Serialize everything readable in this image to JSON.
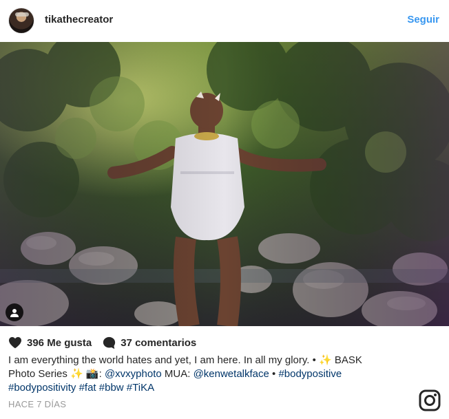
{
  "post": {
    "username": "tikathecreator",
    "follow_label": "Seguir",
    "likes": "396 Me gusta",
    "comments": "37 comentarios",
    "caption": {
      "line1_text": "I am everything the world hates and yet, I am here. In all my glory. • ",
      "line1_emoji": "✨",
      "line1_tail": "  BASK",
      "line2_a": "Photo Series ",
      "line2_emoji1": "✨",
      "line2_emoji2": "📸",
      "line2_b": ": ",
      "mention1": "@xvxyphoto",
      "line2_c": " MUA: ",
      "mention2": "@kenwetalkface",
      "line2_d": " • ",
      "tag1": "#bodypositive",
      "tag2": "#bodypositivity",
      "tag3": "#fat",
      "tag4": "#bbw",
      "tag5": "#TiKA"
    },
    "timestamp": "HACE 7 DÍAS"
  },
  "icons": {
    "avatar": "profile-avatar",
    "tag": "person-tag-icon",
    "like": "heart-icon",
    "comment": "comment-bubble-icon",
    "brand": "instagram-glyph-icon"
  },
  "colors": {
    "link": "#003569",
    "follow": "#3897f0",
    "text": "#262626",
    "muted": "#999999"
  }
}
